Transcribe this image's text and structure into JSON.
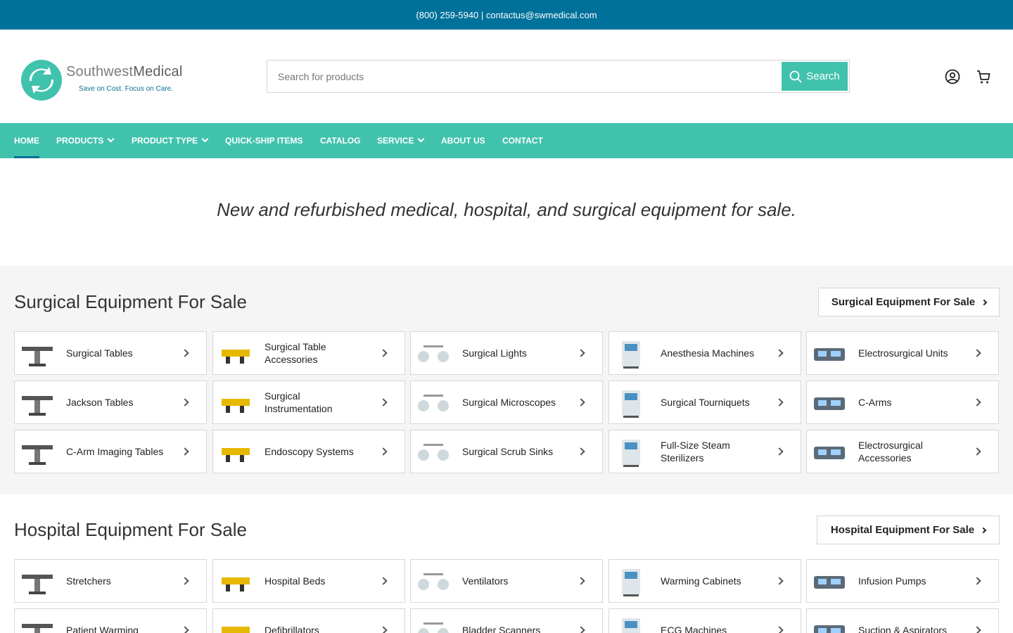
{
  "topbar": {
    "contact": "(800) 259-5940 | contactus@swmedical.com"
  },
  "logo": {
    "name_light": "Southwest",
    "name_bold": "Medical",
    "tagline": "Save on Cost. Focus on Care."
  },
  "search": {
    "placeholder": "Search for products",
    "button": "Search"
  },
  "nav": [
    {
      "label": "HOME"
    },
    {
      "label": "PRODUCTS"
    },
    {
      "label": "PRODUCT TYPE"
    },
    {
      "label": "QUICK-SHIP ITEMS"
    },
    {
      "label": "CATALOG"
    },
    {
      "label": "SERVICE"
    },
    {
      "label": "ABOUT US"
    },
    {
      "label": "CONTACT"
    }
  ],
  "tagline": "New and refurbished medical, hospital, and surgical equipment for sale.",
  "surgical": {
    "title": "Surgical Equipment For Sale",
    "button": "Surgical Equipment For Sale",
    "items": [
      "Surgical Tables",
      "Surgical Table Accessories",
      "Surgical Lights",
      "Anesthesia Machines",
      "Electrosurgical Units",
      "Jackson Tables",
      "Surgical Instrumentation",
      "Surgical Microscopes",
      "Surgical Tourniquets",
      "C-Arms",
      "C-Arm Imaging Tables",
      "Endoscopy Systems",
      "Surgical Scrub Sinks",
      "Full-Size Steam Sterilizers",
      "Electrosurgical Accessories"
    ]
  },
  "hospital": {
    "title": "Hospital Equipment For Sale",
    "button": "Hospital Equipment For Sale",
    "items": [
      "Stretchers",
      "Hospital Beds",
      "Ventilators",
      "Warming Cabinets",
      "Infusion Pumps",
      "Patient Warming",
      "Defibrillators",
      "Bladder Scanners",
      "ECG Machines",
      "Suction & Aspirators"
    ]
  },
  "colors": {
    "topbar": "#00719a",
    "accent": "#41c2ad",
    "active_underline": "#0a6f93"
  }
}
